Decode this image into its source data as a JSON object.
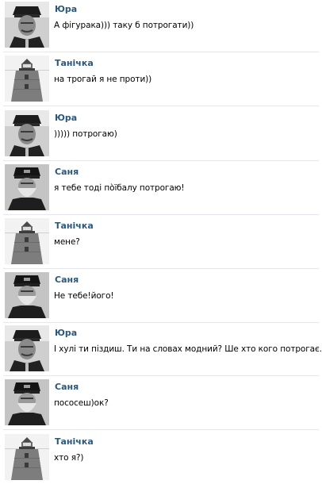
{
  "colors": {
    "author_name": "#2b587a",
    "message_text": "#000000",
    "background": "#ffffff",
    "separator": "#e4e8ee"
  },
  "messages": [
    {
      "author": "Юра",
      "avatar": "captain-portrait",
      "text": "А фігурака))) таку б потрогати))"
    },
    {
      "author": "Танічка",
      "avatar": "lighthouse",
      "text": "на трогай я не проти))"
    },
    {
      "author": "Юра",
      "avatar": "captain-portrait",
      "text": ")))))  потрогаю)"
    },
    {
      "author": "Саня",
      "avatar": "bearded-keeper",
      "text": "я тебе тоді по̀їбалу потрогаю!"
    },
    {
      "author": "Танічка",
      "avatar": "lighthouse",
      "text": "мене?"
    },
    {
      "author": "Саня",
      "avatar": "bearded-keeper",
      "text": "Не тебе!його!"
    },
    {
      "author": "Юра",
      "avatar": "captain-portrait",
      "text": "І хулі ти піздиш. Ти на словах модний? Ше хто кого потрогає."
    },
    {
      "author": "Саня",
      "avatar": "bearded-keeper",
      "text": "пососеш)ок?"
    },
    {
      "author": "Танічка",
      "avatar": "lighthouse",
      "text": "хто я?)"
    }
  ]
}
